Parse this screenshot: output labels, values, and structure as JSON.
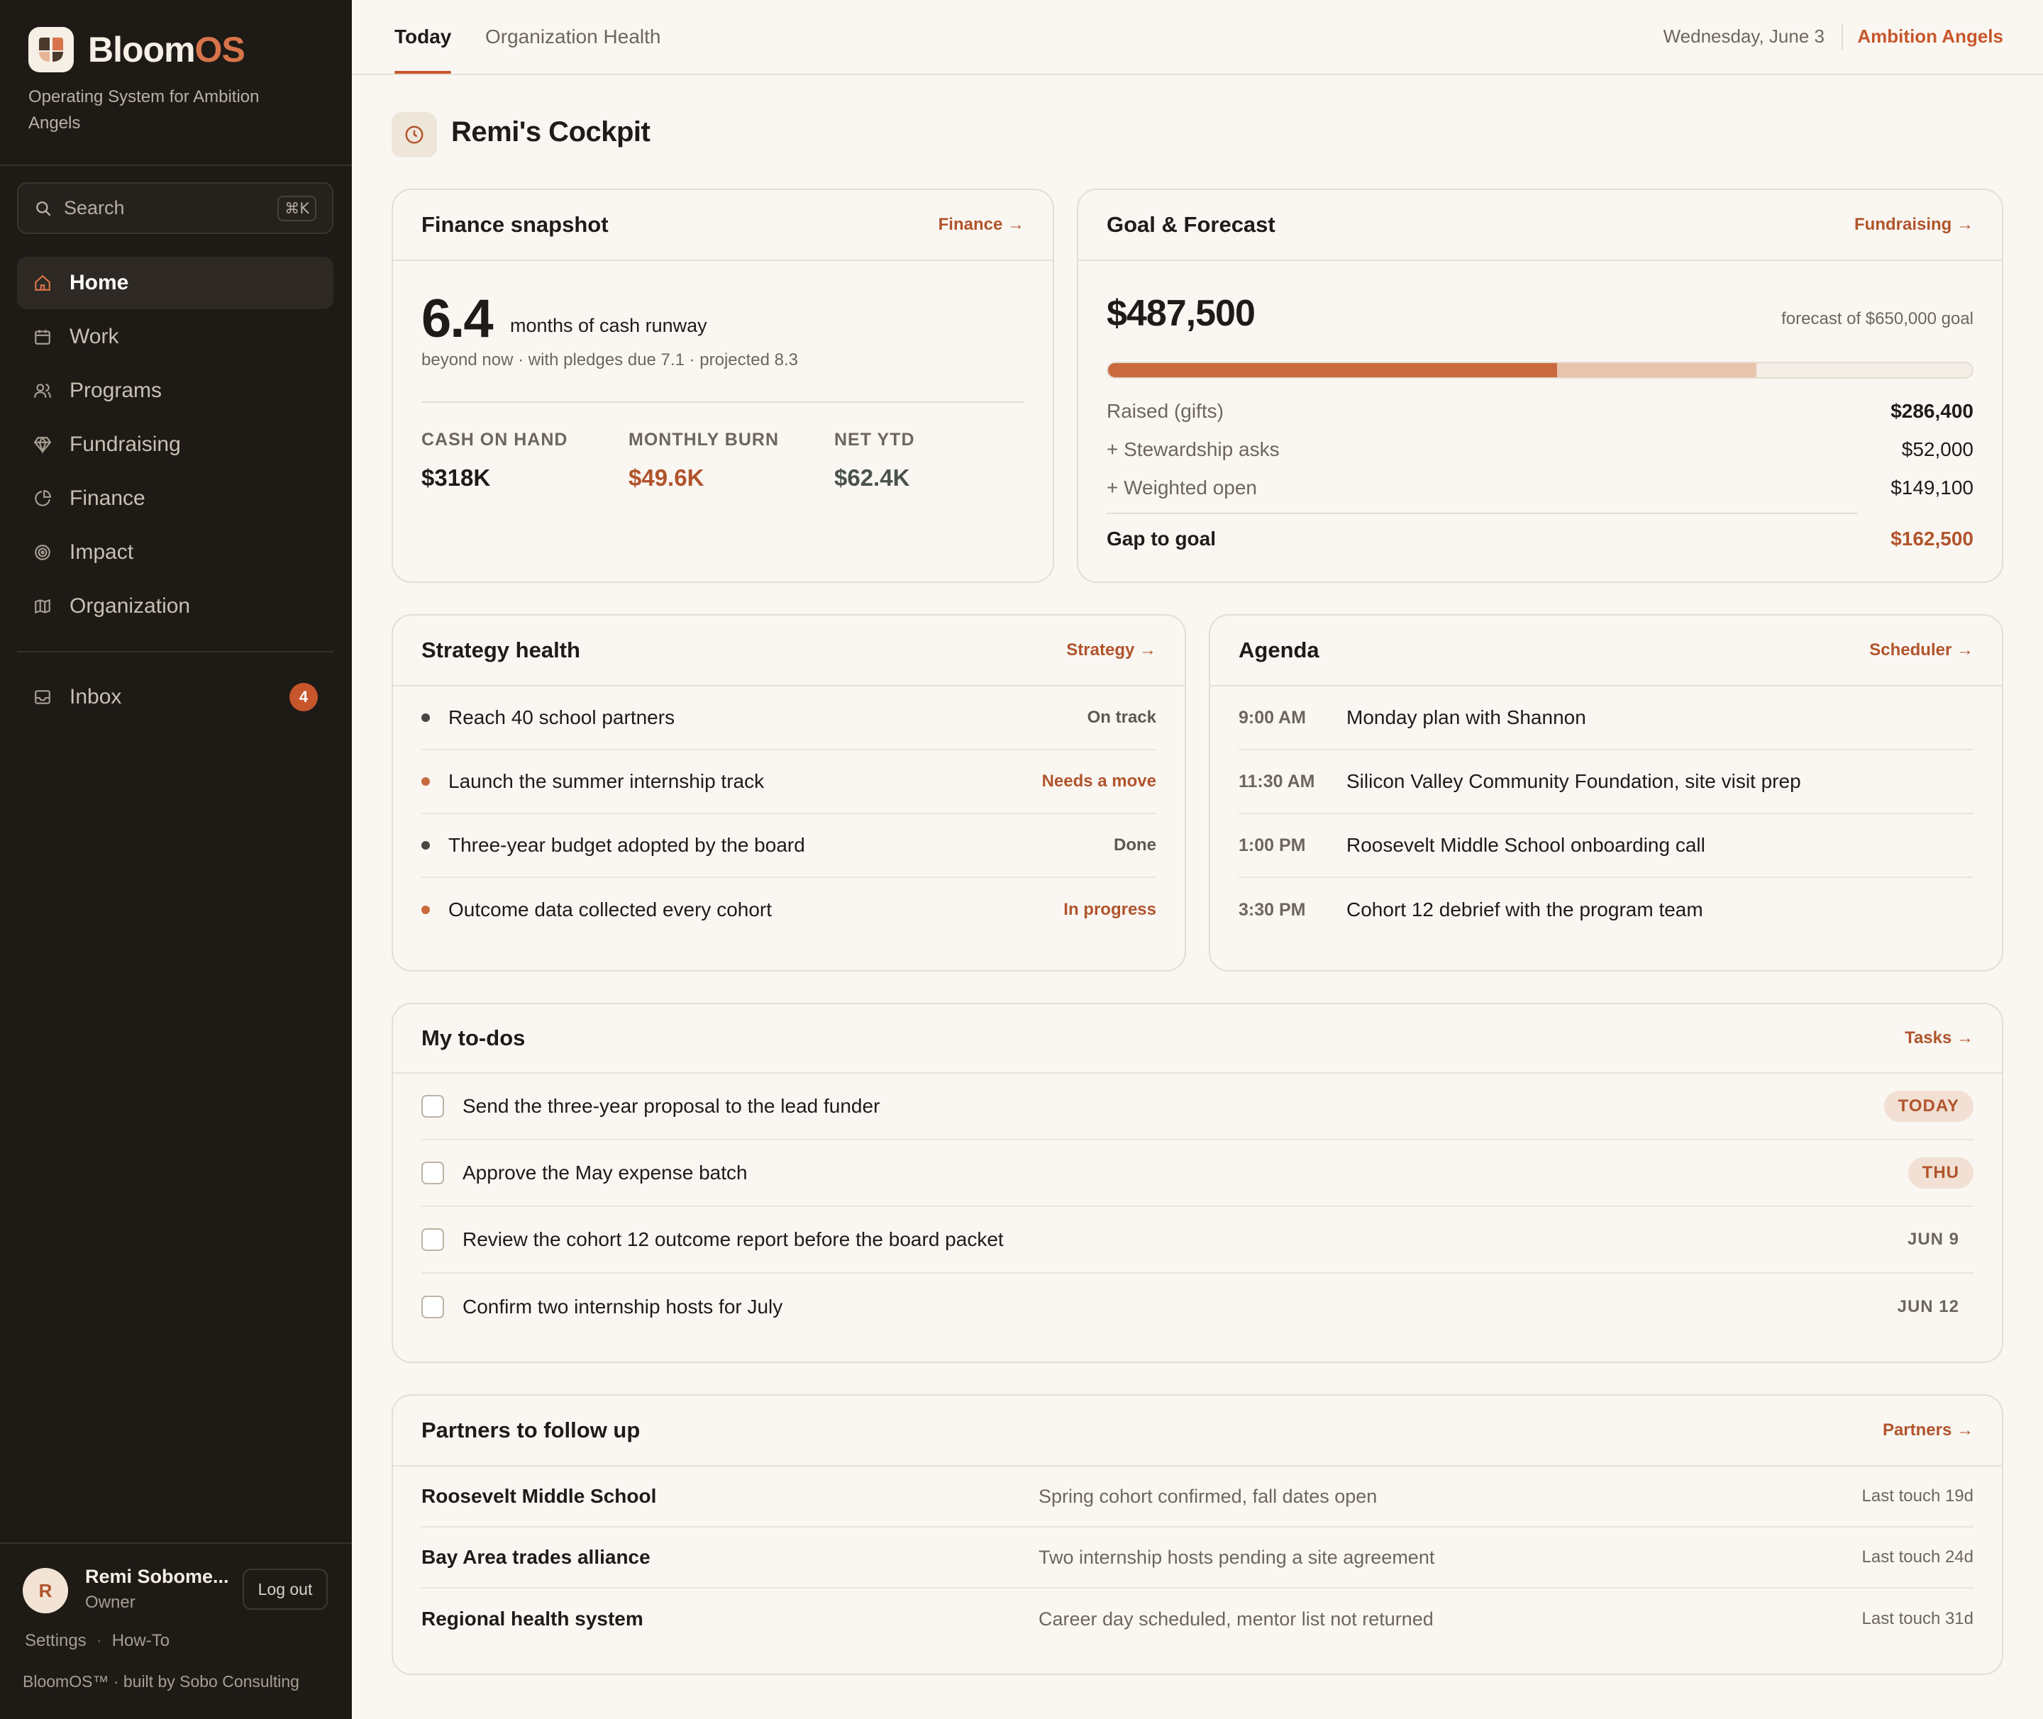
{
  "app": {
    "brand_main": "Bloom",
    "brand_accent": "OS",
    "tagline": "Operating System for Ambition Angels",
    "accent_color": "#c8562c"
  },
  "search": {
    "label": "Search",
    "shortcut": "⌘K"
  },
  "nav": {
    "items": [
      {
        "label": "Home",
        "icon": "home-icon",
        "active": true
      },
      {
        "label": "Work",
        "icon": "calendar-icon"
      },
      {
        "label": "Programs",
        "icon": "users-icon"
      },
      {
        "label": "Fundraising",
        "icon": "gem-icon"
      },
      {
        "label": "Finance",
        "icon": "pie-chart-icon"
      },
      {
        "label": "Impact",
        "icon": "target-icon"
      },
      {
        "label": "Organization",
        "icon": "map-icon"
      }
    ],
    "inbox": {
      "label": "Inbox",
      "count": "4",
      "icon": "inbox-icon"
    }
  },
  "user": {
    "initial": "R",
    "name": "Remi Sobome...",
    "role": "Owner",
    "logout_label": "Log out",
    "links": [
      "Settings",
      "How-To"
    ],
    "footer": "BloomOS™ · built by Sobo Consulting"
  },
  "topbar": {
    "tabs": [
      "Today",
      "Organization Health"
    ],
    "date": "Wednesday, June 3",
    "org": "Ambition Angels"
  },
  "page": {
    "title": "Remi's Cockpit",
    "icon": "clock-icon"
  },
  "finance": {
    "title": "Finance snapshot",
    "link": "Finance →",
    "runway": "6.4",
    "runway_label": "months of cash runway",
    "runway_sub": "beyond now · with pledges due 7.1 · projected 8.3",
    "stats": [
      {
        "label": "CASH ON HAND",
        "value": "$318K",
        "color": "#1f1b18"
      },
      {
        "label": "MONTHLY BURN",
        "value": "$49.6K",
        "color": "#b1542c"
      },
      {
        "label": "NET YTD",
        "value": "$62.4K",
        "color": "#4a524d"
      }
    ]
  },
  "goal": {
    "title": "Goal & Forecast",
    "link": "Fundraising →",
    "amount": "$487,500",
    "sub": "forecast of $650,000 goal",
    "progress_raised_pct": 52,
    "progress_forecast_pct": 75,
    "rows": [
      {
        "label": "Raised (gifts)",
        "value": "$286,400"
      },
      {
        "label": "+ Stewardship asks",
        "value": "$52,000"
      },
      {
        "label": "+ Weighted open",
        "value": "$149,100"
      }
    ],
    "gap_label": "Gap to goal",
    "gap_value": "$162,500"
  },
  "strategy": {
    "title": "Strategy health",
    "link": "Strategy →",
    "items": [
      {
        "text": "Reach 40 school partners",
        "status": "On track",
        "dot": "#4a4742",
        "status_color": "#5f5850"
      },
      {
        "text": "Launch the summer internship track",
        "status": "Needs a move",
        "dot": "#c96a3e",
        "status_color": "#b1542c"
      },
      {
        "text": "Three-year budget adopted by the board",
        "status": "Done",
        "dot": "#4a4742",
        "status_color": "#5f5850"
      },
      {
        "text": "Outcome data collected every cohort",
        "status": "In progress",
        "dot": "#c96a3e",
        "status_color": "#b1542c"
      }
    ]
  },
  "agenda": {
    "title": "Agenda",
    "link": "Scheduler →",
    "items": [
      {
        "time": "9:00 AM",
        "text": "Monday plan with Shannon"
      },
      {
        "time": "11:30 AM",
        "text": "Silicon Valley Community Foundation, site visit prep"
      },
      {
        "time": "1:00 PM",
        "text": "Roosevelt Middle School onboarding call"
      },
      {
        "time": "3:30 PM",
        "text": "Cohort 12 debrief with the program team"
      }
    ]
  },
  "todos": {
    "title": "My to-dos",
    "link": "Tasks →",
    "items": [
      {
        "text": "Send the three-year proposal to the lead funder",
        "due": "TODAY",
        "highlight": true
      },
      {
        "text": "Approve the May expense batch",
        "due": "THU",
        "highlight": true
      },
      {
        "text": "Review the cohort 12 outcome report before the board packet",
        "due": "JUN 9",
        "highlight": false
      },
      {
        "text": "Confirm two internship hosts for July",
        "due": "JUN 12",
        "highlight": false
      }
    ]
  },
  "partners": {
    "title": "Partners to follow up",
    "link": "Partners →",
    "items": [
      {
        "name": "Roosevelt Middle School",
        "note": "Spring cohort confirmed, fall dates open",
        "touch": "Last touch 19d"
      },
      {
        "name": "Bay Area trades alliance",
        "note": "Two internship hosts pending a site agreement",
        "touch": "Last touch 24d"
      },
      {
        "name": "Regional health system",
        "note": "Career day scheduled, mentor list not returned",
        "touch": "Last touch 31d"
      }
    ]
  }
}
